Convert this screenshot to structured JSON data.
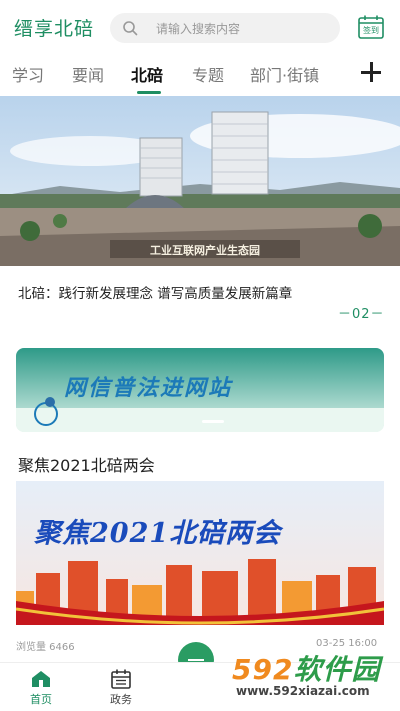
{
  "header": {
    "brand": "缙享北碚",
    "search_placeholder": "请输入搜索内容",
    "signin_label": "签到"
  },
  "tabs": [
    {
      "label": "学习",
      "active": false
    },
    {
      "label": "要闻",
      "active": false
    },
    {
      "label": "北碚",
      "active": true
    },
    {
      "label": "专题",
      "active": false
    },
    {
      "label": "部门·街镇",
      "active": false
    }
  ],
  "hero": {
    "image_text": "工业互联网产业生态园",
    "caption": "北碚：践行新发展理念 谱写高质量发展新篇章",
    "page_indicator": "－02－"
  },
  "banner1": {
    "text": "网信普法进网站"
  },
  "section": {
    "title": "聚焦2021北碚两会",
    "banner_text": "聚焦2021北碚两会",
    "views": "浏览量 6466",
    "date": "03-25 16:00"
  },
  "bottom_nav": [
    {
      "label": "首页",
      "icon": "home-icon",
      "active": true
    },
    {
      "label": "政务",
      "icon": "calendar-icon",
      "active": false
    }
  ],
  "watermark": {
    "brand_num": "592",
    "brand_text": "软件园",
    "url": "www.592xiazai.com"
  },
  "colors": {
    "accent": "#1f8e63",
    "search_bg": "#f1f1f1",
    "wm_orange": "#f08a1f",
    "wm_green": "#2d9c4a"
  }
}
